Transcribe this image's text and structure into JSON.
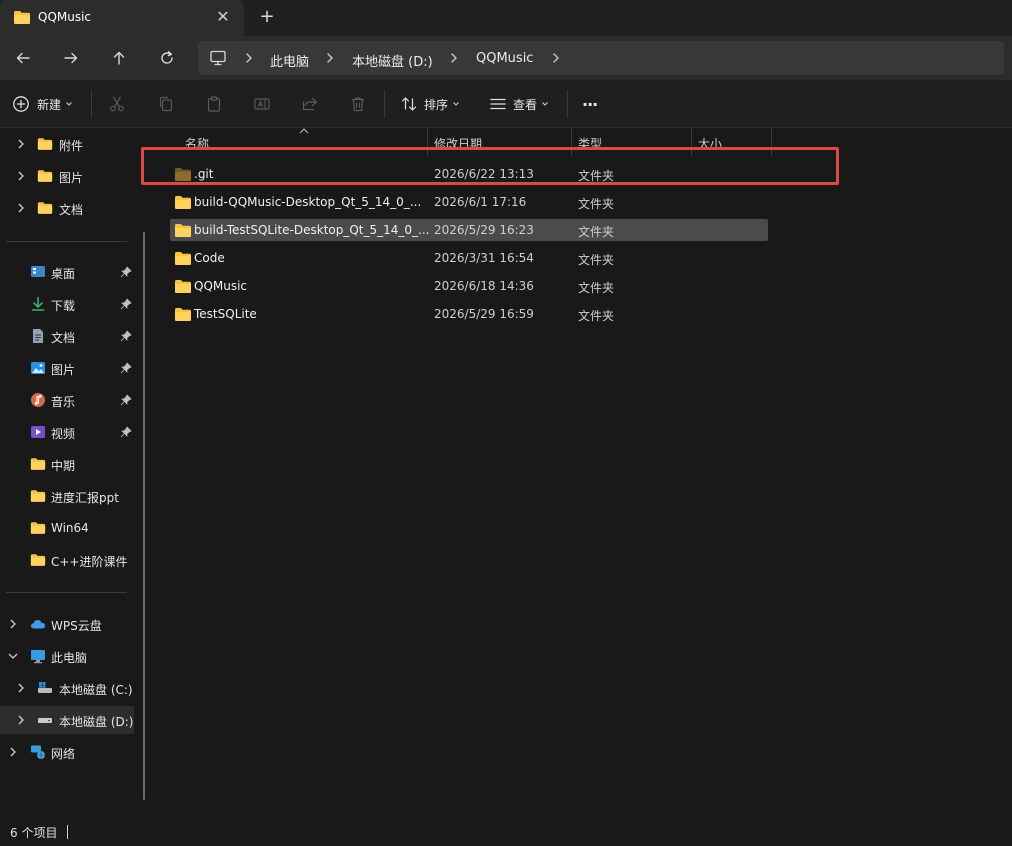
{
  "tab": {
    "title": "QQMusic",
    "close_glyph": "✕",
    "new_tab_glyph": "+"
  },
  "breadcrumb": [
    "此电脑",
    "本地磁盘 (D:)",
    "QQMusic"
  ],
  "toolbar": {
    "new_label": "新建",
    "sort_label": "排序",
    "view_label": "查看",
    "more_label": "···"
  },
  "sidebar": {
    "top_items": [
      {
        "label": "附件",
        "icon": "folder-icon"
      },
      {
        "label": "图片",
        "icon": "folder-icon"
      },
      {
        "label": "文档",
        "icon": "folder-icon"
      }
    ],
    "quick_access": [
      {
        "label": "桌面",
        "icon": "desktop-icon",
        "pinned": true
      },
      {
        "label": "下载",
        "icon": "download-icon",
        "pinned": true
      },
      {
        "label": "文档",
        "icon": "document-icon",
        "pinned": true
      },
      {
        "label": "图片",
        "icon": "picture-icon",
        "pinned": true
      },
      {
        "label": "音乐",
        "icon": "music-icon",
        "pinned": true
      },
      {
        "label": "视频",
        "icon": "video-icon",
        "pinned": true
      },
      {
        "label": "中期",
        "icon": "folder-icon",
        "pinned": false
      },
      {
        "label": "进度汇报ppt",
        "icon": "folder-icon",
        "pinned": false
      },
      {
        "label": "Win64",
        "icon": "folder-icon",
        "pinned": false
      },
      {
        "label": "C++进阶课件",
        "icon": "folder-icon",
        "pinned": false
      }
    ],
    "locations": [
      {
        "label": "WPS云盘",
        "icon": "cloud-icon"
      },
      {
        "label": "此电脑",
        "icon": "pc-icon"
      },
      {
        "label": "本地磁盘 (C:)",
        "icon": "drive-icon"
      },
      {
        "label": "本地磁盘 (D:)",
        "icon": "drive-icon"
      },
      {
        "label": "网络",
        "icon": "network-icon"
      }
    ]
  },
  "columns": {
    "name": "名称",
    "modified": "修改日期",
    "type": "类型",
    "size": "大小"
  },
  "files": [
    {
      "name": ".git",
      "modified": "2026/6/22 13:13",
      "type": "文件夹"
    },
    {
      "name": "build-QQMusic-Desktop_Qt_5_14_0_...",
      "modified": "2026/6/1 17:16",
      "type": "文件夹"
    },
    {
      "name": "build-TestSQLite-Desktop_Qt_5_14_0_...",
      "modified": "2026/5/29 16:23",
      "type": "文件夹"
    },
    {
      "name": "Code",
      "modified": "2026/3/31 16:54",
      "type": "文件夹"
    },
    {
      "name": "QQMusic",
      "modified": "2026/6/18 14:36",
      "type": "文件夹"
    },
    {
      "name": "TestSQLite",
      "modified": "2026/5/29 16:59",
      "type": "文件夹"
    }
  ],
  "status": {
    "item_count": "6 个项目"
  },
  "colors": {
    "folder": "#f4c542",
    "hidden_folder": "#8a6e2f",
    "highlight": "#e04848",
    "selected_row": "#4b4b4b"
  }
}
